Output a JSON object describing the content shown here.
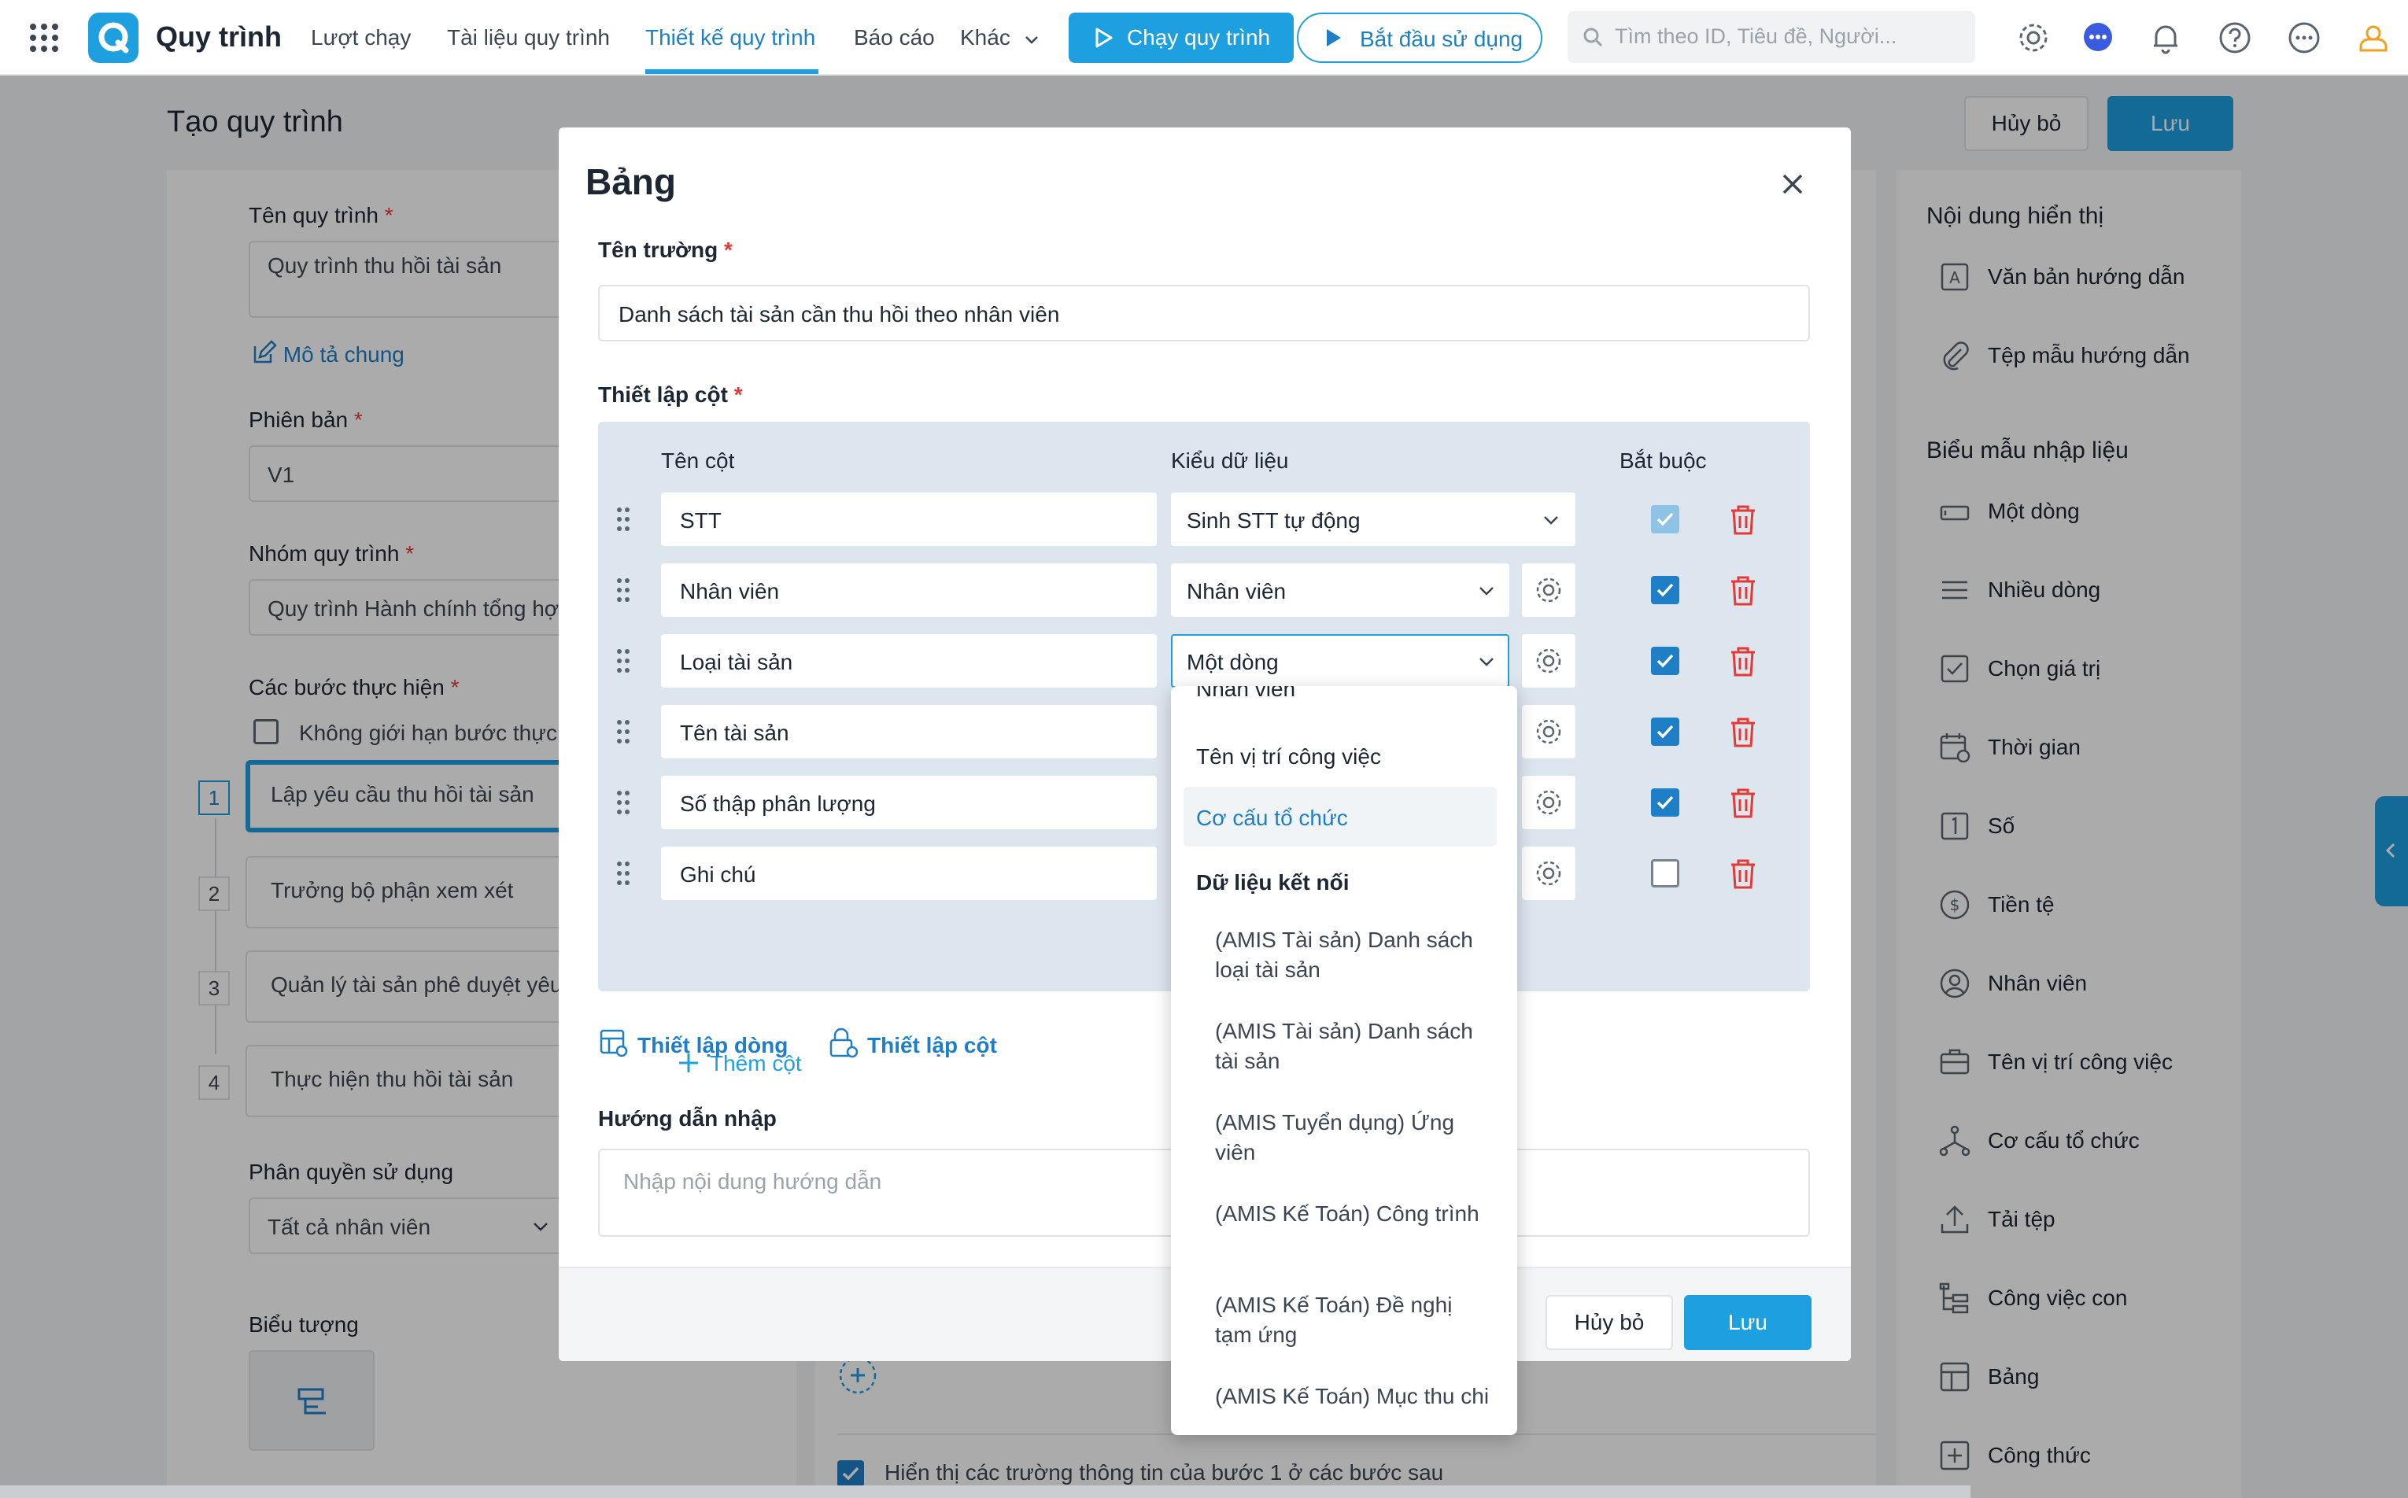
{
  "topbar": {
    "app_title": "Quy trình",
    "nav": [
      "Lượt chạy",
      "Tài liệu quy trình",
      "Thiết kế quy trình",
      "Báo cáo",
      "Khác"
    ],
    "run_button": "Chạy quy trình",
    "start_button": "Bắt đầu sử dụng",
    "search_placeholder": "Tìm theo ID, Tiêu đề, Người...",
    "colors": {
      "accent": "#1e9fe0",
      "active_nav": "#1e7fc6"
    }
  },
  "page": {
    "title": "Tạo quy trình",
    "cancel": "Hủy bỏ",
    "save": "Lưu"
  },
  "form": {
    "name_label": "Tên quy trình",
    "name_value": "Quy trình thu hồi tài sản",
    "desc_link": "Mô tả chung",
    "version_label": "Phiên bản",
    "version_value": "V1",
    "group_label": "Nhóm quy trình",
    "group_value": "Quy trình Hành chính tổng hợp",
    "steps_label": "Các bước thực hiện",
    "unlimited_steps": "Không giới hạn bước thực hiện",
    "steps": [
      {
        "num": "1",
        "label": "Lập yêu cầu thu hồi tài sản"
      },
      {
        "num": "2",
        "label": "Trưởng bộ phận xem xét"
      },
      {
        "num": "3",
        "label": "Quản lý tài sản phê duyệt yêu cầu"
      },
      {
        "num": "4",
        "label": "Thực hiện thu hồi tài sản"
      }
    ],
    "permission_label": "Phân quyền sử dụng",
    "permission_value": "Tất cả nhân viên",
    "icon_label": "Biểu tượng"
  },
  "middle": {
    "show_fields_checkbox": "Hiển thị các trường thông tin của bước 1 ở các bước sau"
  },
  "right_panel": {
    "display_heading": "Nội dung hiển thị",
    "display_items": [
      {
        "label": "Văn bản hướng dẫn",
        "icon": "text-box-icon"
      },
      {
        "label": "Tệp mẫu hướng dẫn",
        "icon": "paperclip-icon"
      }
    ],
    "form_heading": "Biểu mẫu nhập liệu",
    "form_items": [
      {
        "label": "Một dòng",
        "icon": "single-line-icon"
      },
      {
        "label": "Nhiều dòng",
        "icon": "multi-line-icon"
      },
      {
        "label": "Chọn giá trị",
        "icon": "checkbox-icon"
      },
      {
        "label": "Thời gian",
        "icon": "calendar-icon"
      },
      {
        "label": "Số",
        "icon": "number-icon"
      },
      {
        "label": "Tiền tệ",
        "icon": "dollar-icon"
      },
      {
        "label": "Nhân viên",
        "icon": "user-icon"
      },
      {
        "label": "Tên vị trí công việc",
        "icon": "briefcase-icon"
      },
      {
        "label": "Cơ cấu tổ chức",
        "icon": "org-chart-icon"
      },
      {
        "label": "Tải tệp",
        "icon": "upload-icon"
      },
      {
        "label": "Công việc con",
        "icon": "subtask-icon"
      },
      {
        "label": "Bảng",
        "icon": "table-icon"
      },
      {
        "label": "Công thức",
        "icon": "formula-icon"
      }
    ]
  },
  "modal": {
    "title": "Bảng",
    "field_name_label": "Tên trường",
    "field_name_value": "Danh sách tài sản cần thu hồi theo nhân viên",
    "column_setup_label": "Thiết lập cột",
    "headers": {
      "name": "Tên cột",
      "type": "Kiểu dữ liệu",
      "required": "Bắt buộc"
    },
    "columns": [
      {
        "name": "STT",
        "type": "Sinh STT tự động",
        "required": "disabled"
      },
      {
        "name": "Nhân viên",
        "type": "Nhân viên",
        "required": "checked"
      },
      {
        "name": "Loại tài sản",
        "type": "Một dòng",
        "required": "checked"
      },
      {
        "name": "Tên tài sản",
        "type": "",
        "required": "checked"
      },
      {
        "name": "Số thập phân lượng",
        "type": "",
        "required": "checked"
      },
      {
        "name": "Ghi chú",
        "type": "",
        "required": "unchecked"
      }
    ],
    "add_column": "Thêm cột",
    "row_setup_link": "Thiết lập dòng",
    "col_setup_link": "Thiết lập cột",
    "guide_label": "Hướng dẫn nhập",
    "guide_placeholder": "Nhập nội dung hướng dẫn",
    "cancel": "Hủy bỏ",
    "save": "Lưu"
  },
  "dropdown": {
    "items": [
      "Nhân viên",
      "Tên vị trí công việc",
      "Cơ cấu tổ chức"
    ],
    "highlighted": "Cơ cấu tổ chức",
    "group_heading": "Dữ liệu kết nối",
    "connected": [
      "(AMIS Tài sản) Danh sách loại tài sản",
      "(AMIS Tài sản) Danh sách tài sản",
      "(AMIS Tuyển dụng) Ứng viên",
      "(AMIS Kế Toán) Công trình",
      "(AMIS Kế Toán) Đề nghị tạm ứng",
      "(AMIS Kế Toán) Mục thu chi"
    ]
  }
}
